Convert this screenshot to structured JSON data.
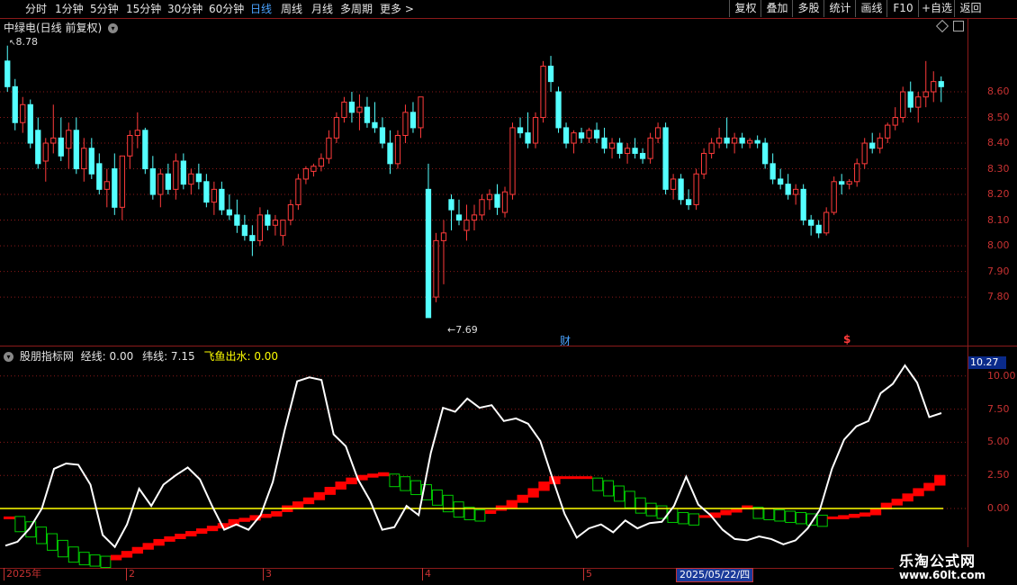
{
  "toolbar": {
    "periods": [
      {
        "label": "分时",
        "active": false
      },
      {
        "label": "1分钟",
        "active": false
      },
      {
        "label": "5分钟",
        "active": false
      },
      {
        "label": "15分钟",
        "active": false
      },
      {
        "label": "30分钟",
        "active": false
      },
      {
        "label": "60分钟",
        "active": false
      },
      {
        "label": "日线",
        "active": true
      },
      {
        "label": "周线",
        "active": false
      },
      {
        "label": "月线",
        "active": false
      },
      {
        "label": "多周期",
        "active": false
      },
      {
        "label": "更多 >",
        "active": false
      }
    ],
    "buttons": [
      "复权",
      "叠加",
      "多股",
      "统计",
      "画线",
      "F10",
      "+自选",
      "返回"
    ]
  },
  "main_chart": {
    "title": "中绿电(日线 前复权)",
    "high_label": "8.78",
    "low_label": "7.69",
    "event_label_cai": "财",
    "event_label_s": "$",
    "y_ticks": [
      "8.60",
      "8.50",
      "8.40",
      "8.30",
      "8.20",
      "8.10",
      "8.00",
      "7.90",
      "7.80"
    ]
  },
  "indicator": {
    "name": "股朋指标网",
    "jing_label": "经线: 0.00",
    "wei_label": "纬线: 7.15",
    "feiyu_label": "飞鱼出水: 0.00",
    "current_value": "10.27",
    "y_ticks": [
      "10.00",
      "7.50",
      "5.00",
      "2.50",
      "0.00"
    ]
  },
  "date_axis": {
    "labels": [
      "2025年",
      "2",
      "3",
      "4",
      "5"
    ],
    "cursor_date": "2025/05/22/四"
  },
  "watermark": {
    "line1": "乐淘公式网",
    "line2": "www.60lt.com"
  },
  "colors": {
    "up": "#ff3b3b",
    "down": "#54ffff",
    "grid": "#8b1a1a",
    "white_line": "#ffffff",
    "zero_line": "#ffff00",
    "green_box": "#00cc00",
    "red_fill": "#ff0000"
  },
  "chart_data": [
    {
      "type": "candlestick",
      "title": "中绿电(日线 前复权)",
      "y_range": [
        7.69,
        8.78
      ],
      "candles": [
        [
          8.72,
          8.78,
          8.6,
          8.62
        ],
        [
          8.62,
          8.65,
          8.45,
          8.48
        ],
        [
          8.48,
          8.58,
          8.44,
          8.55
        ],
        [
          8.55,
          8.57,
          8.38,
          8.4
        ],
        [
          8.45,
          8.5,
          8.3,
          8.32
        ],
        [
          8.33,
          8.42,
          8.25,
          8.4
        ],
        [
          8.4,
          8.55,
          8.36,
          8.42
        ],
        [
          8.42,
          8.5,
          8.33,
          8.35
        ],
        [
          8.38,
          8.48,
          8.3,
          8.45
        ],
        [
          8.45,
          8.5,
          8.28,
          8.3
        ],
        [
          8.3,
          8.42,
          8.25,
          8.38
        ],
        [
          8.38,
          8.42,
          8.26,
          8.28
        ],
        [
          8.32,
          8.36,
          8.2,
          8.22
        ],
        [
          8.22,
          8.3,
          8.15,
          8.25
        ],
        [
          8.3,
          8.36,
          8.12,
          8.15
        ],
        [
          8.15,
          8.35,
          8.1,
          8.35
        ],
        [
          8.35,
          8.45,
          8.3,
          8.43
        ],
        [
          8.43,
          8.52,
          8.38,
          8.45
        ],
        [
          8.45,
          8.46,
          8.28,
          8.3
        ],
        [
          8.3,
          8.35,
          8.18,
          8.2
        ],
        [
          8.2,
          8.3,
          8.15,
          8.28
        ],
        [
          8.28,
          8.32,
          8.2,
          8.22
        ],
        [
          8.22,
          8.36,
          8.18,
          8.33
        ],
        [
          8.33,
          8.36,
          8.22,
          8.24
        ],
        [
          8.24,
          8.3,
          8.2,
          8.28
        ],
        [
          8.28,
          8.32,
          8.22,
          8.25
        ],
        [
          8.25,
          8.28,
          8.15,
          8.17
        ],
        [
          8.17,
          8.25,
          8.12,
          8.22
        ],
        [
          8.22,
          8.25,
          8.12,
          8.14
        ],
        [
          8.14,
          8.2,
          8.1,
          8.12
        ],
        [
          8.12,
          8.18,
          8.05,
          8.08
        ],
        [
          8.08,
          8.12,
          8.02,
          8.04
        ],
        [
          8.04,
          8.08,
          7.96,
          8.02
        ],
        [
          8.02,
          8.15,
          8.0,
          8.12
        ],
        [
          8.12,
          8.14,
          8.06,
          8.08
        ],
        [
          8.08,
          8.12,
          8.04,
          8.1
        ],
        [
          8.04,
          8.1,
          8.0,
          8.1
        ],
        [
          8.1,
          8.18,
          8.08,
          8.16
        ],
        [
          8.16,
          8.28,
          8.14,
          8.26
        ],
        [
          8.26,
          8.31,
          8.24,
          8.3
        ],
        [
          8.29,
          8.32,
          8.27,
          8.31
        ],
        [
          8.31,
          8.36,
          8.29,
          8.34
        ],
        [
          8.34,
          8.45,
          8.32,
          8.42
        ],
        [
          8.42,
          8.52,
          8.4,
          8.5
        ],
        [
          8.5,
          8.58,
          8.48,
          8.56
        ],
        [
          8.56,
          8.6,
          8.48,
          8.52
        ],
        [
          8.52,
          8.59,
          8.45,
          8.54
        ],
        [
          8.54,
          8.58,
          8.46,
          8.48
        ],
        [
          8.48,
          8.56,
          8.44,
          8.46
        ],
        [
          8.46,
          8.5,
          8.38,
          8.4
        ],
        [
          8.4,
          8.45,
          8.28,
          8.32
        ],
        [
          8.32,
          8.45,
          8.3,
          8.43
        ],
        [
          8.43,
          8.55,
          8.4,
          8.52
        ],
        [
          8.52,
          8.56,
          8.44,
          8.46
        ],
        [
          8.46,
          8.58,
          8.42,
          8.58
        ],
        [
          8.22,
          8.32,
          7.72,
          7.72
        ],
        [
          7.8,
          8.05,
          7.78,
          8.02
        ],
        [
          8.02,
          8.1,
          7.85,
          8.05
        ],
        [
          8.18,
          8.2,
          8.06,
          8.14
        ],
        [
          8.12,
          8.18,
          8.08,
          8.1
        ],
        [
          8.06,
          8.16,
          8.02,
          8.1
        ],
        [
          8.1,
          8.16,
          8.06,
          8.12
        ],
        [
          8.12,
          8.2,
          8.1,
          8.18
        ],
        [
          8.18,
          8.22,
          8.14,
          8.2
        ],
        [
          8.2,
          8.24,
          8.12,
          8.15
        ],
        [
          8.13,
          8.23,
          8.11,
          8.21
        ],
        [
          8.2,
          8.48,
          8.18,
          8.46
        ],
        [
          8.46,
          8.5,
          8.42,
          8.44
        ],
        [
          8.44,
          8.52,
          8.38,
          8.4
        ],
        [
          8.4,
          8.52,
          8.38,
          8.5
        ],
        [
          8.5,
          8.72,
          8.48,
          8.7
        ],
        [
          8.7,
          8.74,
          8.6,
          8.64
        ],
        [
          8.6,
          8.62,
          8.44,
          8.46
        ],
        [
          8.46,
          8.48,
          8.38,
          8.4
        ],
        [
          8.4,
          8.45,
          8.36,
          8.44
        ],
        [
          8.44,
          8.46,
          8.4,
          8.42
        ],
        [
          8.42,
          8.46,
          8.4,
          8.45
        ],
        [
          8.45,
          8.48,
          8.4,
          8.42
        ],
        [
          8.42,
          8.46,
          8.36,
          8.38
        ],
        [
          8.38,
          8.42,
          8.34,
          8.4
        ],
        [
          8.4,
          8.42,
          8.34,
          8.36
        ],
        [
          8.36,
          8.4,
          8.32,
          8.38
        ],
        [
          8.38,
          8.42,
          8.34,
          8.36
        ],
        [
          8.36,
          8.38,
          8.32,
          8.34
        ],
        [
          8.34,
          8.44,
          8.32,
          8.42
        ],
        [
          8.42,
          8.48,
          8.4,
          8.46
        ],
        [
          8.46,
          8.48,
          8.2,
          8.22
        ],
        [
          8.22,
          8.28,
          8.18,
          8.26
        ],
        [
          8.26,
          8.28,
          8.16,
          8.18
        ],
        [
          8.18,
          8.22,
          8.14,
          8.16
        ],
        [
          8.16,
          8.3,
          8.14,
          8.28
        ],
        [
          8.28,
          8.38,
          8.26,
          8.36
        ],
        [
          8.36,
          8.42,
          8.34,
          8.4
        ],
        [
          8.4,
          8.46,
          8.38,
          8.42
        ],
        [
          8.42,
          8.5,
          8.38,
          8.4
        ],
        [
          8.4,
          8.44,
          8.36,
          8.42
        ],
        [
          8.42,
          8.44,
          8.38,
          8.4
        ],
        [
          8.4,
          8.42,
          8.38,
          8.41
        ],
        [
          8.41,
          8.43,
          8.38,
          8.4
        ],
        [
          8.4,
          8.42,
          8.3,
          8.32
        ],
        [
          8.32,
          8.36,
          8.24,
          8.26
        ],
        [
          8.26,
          8.3,
          8.22,
          8.24
        ],
        [
          8.24,
          8.28,
          8.18,
          8.2
        ],
        [
          8.2,
          8.24,
          8.16,
          8.22
        ],
        [
          8.22,
          8.24,
          8.08,
          8.1
        ],
        [
          8.1,
          8.12,
          8.04,
          8.08
        ],
        [
          8.08,
          8.1,
          8.03,
          8.05
        ],
        [
          8.05,
          8.15,
          8.04,
          8.13
        ],
        [
          8.13,
          8.27,
          8.12,
          8.25
        ],
        [
          8.25,
          8.28,
          8.2,
          8.24
        ],
        [
          8.24,
          8.26,
          8.22,
          8.25
        ],
        [
          8.25,
          8.34,
          8.23,
          8.32
        ],
        [
          8.32,
          8.42,
          8.3,
          8.4
        ],
        [
          8.4,
          8.44,
          8.36,
          8.38
        ],
        [
          8.38,
          8.44,
          8.36,
          8.42
        ],
        [
          8.42,
          8.48,
          8.4,
          8.47
        ],
        [
          8.47,
          8.54,
          8.45,
          8.5
        ],
        [
          8.5,
          8.62,
          8.48,
          8.6
        ],
        [
          8.6,
          8.64,
          8.52,
          8.54
        ],
        [
          8.54,
          8.6,
          8.48,
          8.58
        ],
        [
          8.58,
          8.72,
          8.54,
          8.6
        ],
        [
          8.6,
          8.68,
          8.56,
          8.64
        ],
        [
          8.64,
          8.66,
          8.56,
          8.62
        ]
      ]
    },
    {
      "type": "line",
      "title": "股朋指标网",
      "ylim": [
        -3,
        10.27
      ],
      "series": [
        {
          "name": "经线",
          "values": [
            -2.8,
            -2.5,
            -1.5,
            0,
            3,
            3.4,
            3.3,
            1.8,
            -2,
            -2.9,
            -1.2,
            1.5,
            0.2,
            1.8,
            2.5,
            3.1,
            2.2,
            0.2,
            -1.6,
            -1.2,
            -1.6,
            -0.5,
            2,
            6,
            9.6,
            9.9,
            9.7,
            5.6,
            4.7,
            2.2,
            0.6,
            -1.6,
            -1.4,
            0.2,
            -0.5,
            4.2,
            7.6,
            7.3,
            8.3,
            7.6,
            7.8,
            6.6,
            6.8,
            6.4,
            5.1,
            2.3,
            -0.4,
            -2.2,
            -1.5,
            -1.2,
            -1.8,
            -0.9,
            -1.5,
            -1.1,
            -1.0,
            0.2,
            2.4,
            0.3,
            -0.5,
            -1.6,
            -2.3,
            -2.4,
            -2.1,
            -2.3,
            -2.7,
            -2.4,
            -1.5,
            -0.1,
            3,
            5.2,
            6.2,
            6.6,
            8.7,
            9.4,
            10.8,
            9.5,
            6.9,
            7.2
          ]
        },
        {
          "name": "飞鱼出水",
          "values": [
            -0.6,
            -1.0,
            -1.4,
            -1.9,
            -2.4,
            -2.9,
            -3.3,
            -3.5,
            -3.6,
            -3.7,
            -3.5,
            -3.2,
            -2.9,
            -2.6,
            -2.3,
            -2.1,
            -1.9,
            -1.7,
            -1.5,
            -1.3,
            -1.1,
            -0.8,
            -0.7,
            -0.5,
            -0.4,
            -0.2,
            0.1,
            0.4,
            0.7,
            1.1,
            1.5,
            1.9,
            2.2,
            2.4,
            2.5,
            2.6,
            2.4,
            2.1,
            1.8,
            1.4,
            1.0,
            0.5,
            0.1,
            -0.1,
            -0.2,
            -0.1,
            0.1,
            0.5,
            0.9,
            1.4,
            1.9,
            2.3,
            2.3,
            2.3,
            2.3,
            2.1,
            1.7,
            1.3,
            0.8,
            0.4,
            0.2,
            0,
            -0.3,
            -0.4,
            -0.5,
            -0.5,
            -0.3,
            -0.1,
            0,
            0.1,
            0,
            -0.1,
            -0.2,
            -0.3,
            -0.4,
            -0.5,
            -0.6,
            -0.6,
            -0.5,
            -0.4,
            -0.3,
            0,
            0.3,
            0.6,
            1.0,
            1.4,
            1.8,
            2.4
          ]
        },
        {
          "name": "纬线",
          "values": [
            0,
            0,
            0,
            0,
            0,
            0,
            0,
            0,
            0,
            0,
            0,
            0,
            0,
            0,
            0,
            0,
            0,
            0,
            0,
            0,
            0,
            0,
            0,
            0,
            0,
            0,
            0,
            0,
            0,
            0
          ]
        }
      ]
    }
  ]
}
